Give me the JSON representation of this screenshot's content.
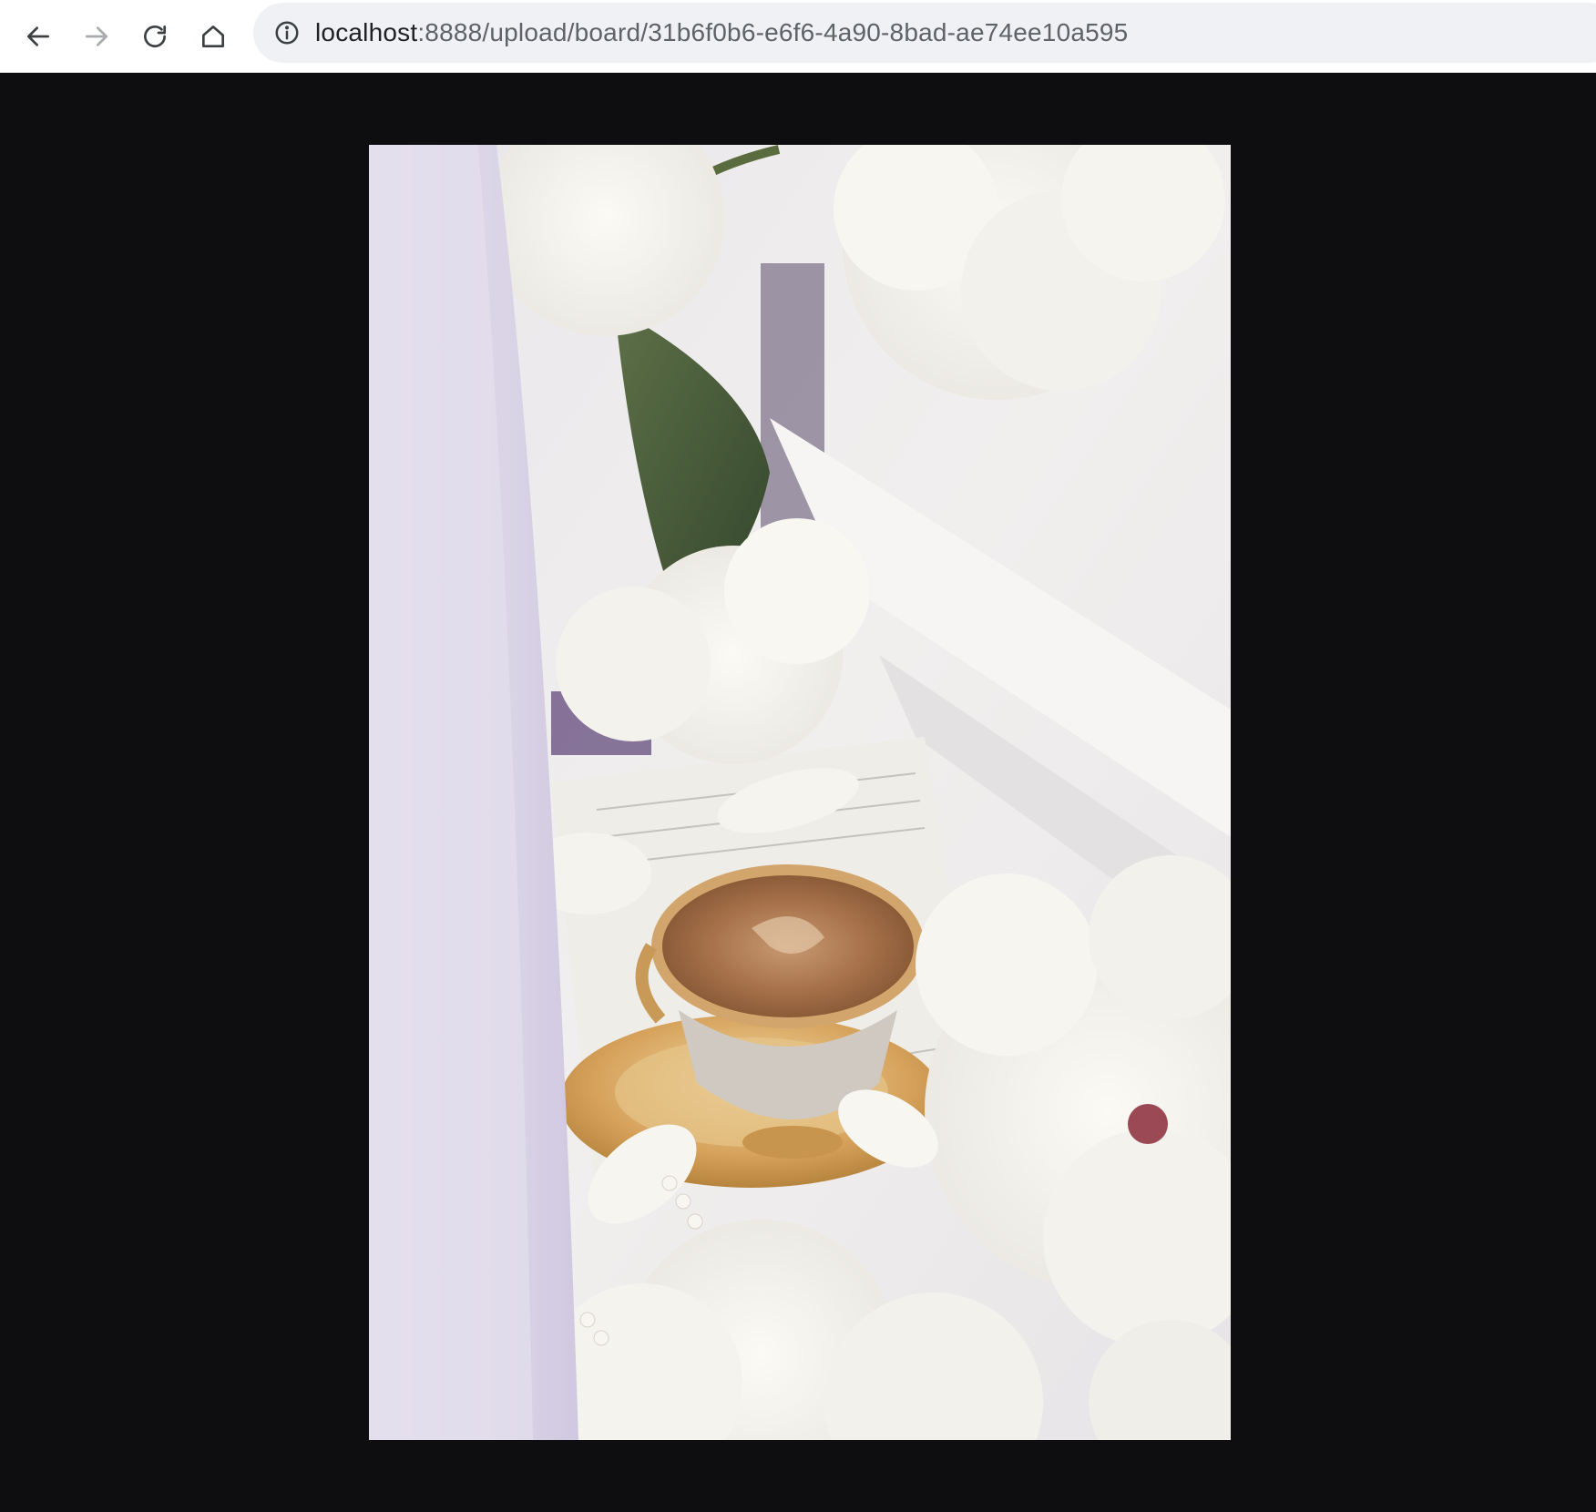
{
  "browser": {
    "url_host": "localhost",
    "url_rest": ":8888/upload/board/31b6f0b6-e6f6-4a90-8bad-ae74ee10a595",
    "icons": {
      "back": "arrow-left-icon",
      "forward": "arrow-right-icon",
      "reload": "reload-icon",
      "home": "home-icon",
      "site_info": "info-circle-icon"
    }
  },
  "viewer": {
    "background_color": "#0e0e10",
    "image_subject": "coffee-cup-with-peonies-photo"
  }
}
